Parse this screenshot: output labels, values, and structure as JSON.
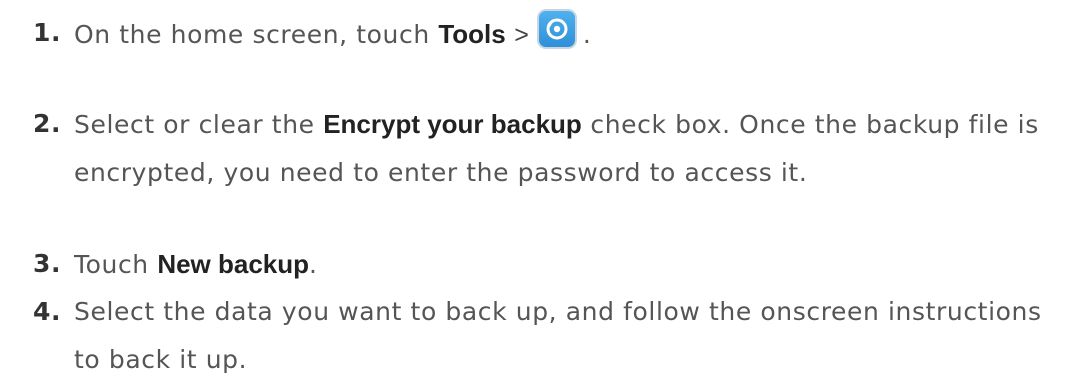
{
  "steps": [
    {
      "number": "1.",
      "prefix": "On the home screen, touch ",
      "bold": "Tools",
      "separator": ">",
      "icon": "backup-app-icon",
      "suffix": "."
    },
    {
      "number": "2.",
      "prefix": "Select or clear the ",
      "bold": "Encrypt your backup",
      "suffix": " check box. Once the backup file is encrypted, you need to enter the password to access it."
    },
    {
      "number": "3.",
      "prefix": "Touch ",
      "bold": "New backup",
      "suffix": "."
    },
    {
      "number": "4.",
      "text": "Select the data you want to back up, and follow the onscreen instructions to back it up."
    }
  ],
  "colors": {
    "text": "#555555",
    "bold": "#222222",
    "icon_blue": "#2f8fd8"
  }
}
